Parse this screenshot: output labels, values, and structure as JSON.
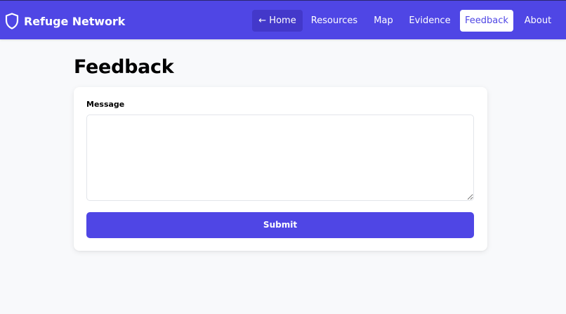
{
  "brand": {
    "name": "Refuge Network",
    "icon": "shield-icon"
  },
  "nav": {
    "items": [
      {
        "label": "← Home",
        "active": false
      },
      {
        "label": "Resources",
        "active": false
      },
      {
        "label": "Map",
        "active": false
      },
      {
        "label": "Evidence",
        "active": false
      },
      {
        "label": "Feedback",
        "active": true
      },
      {
        "label": "About",
        "active": false
      }
    ]
  },
  "page": {
    "title": "Feedback"
  },
  "form": {
    "message_label": "Message",
    "message_value": "",
    "submit_label": "Submit"
  },
  "colors": {
    "accent": "#4f46e5",
    "nav_active_bg": "#4338ca",
    "page_bg": "#f8f9fb",
    "card_bg": "#ffffff"
  }
}
